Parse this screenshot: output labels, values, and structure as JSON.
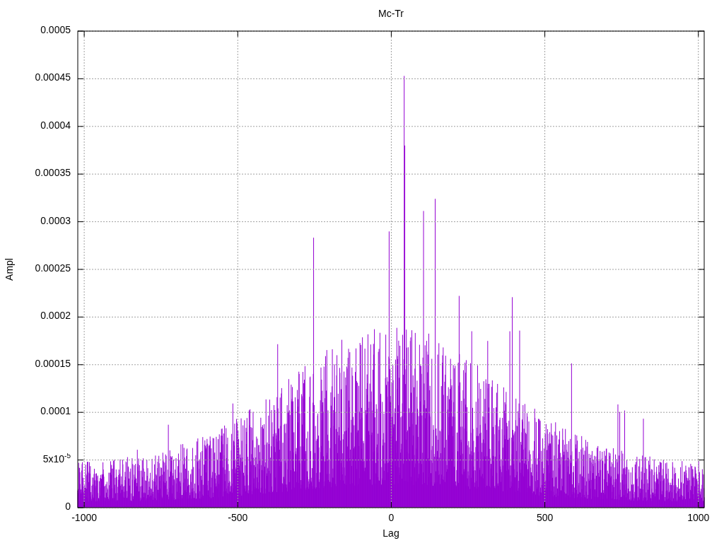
{
  "chart_data": {
    "type": "line",
    "title": "Mc-Tr",
    "xlabel": "Lag",
    "ylabel": "Ampl",
    "xlim": [
      -1021,
      1019
    ],
    "ylim": [
      0,
      0.0005
    ],
    "grid": true,
    "xticks": [
      {
        "value": -1000,
        "label": "-1000"
      },
      {
        "value": -500,
        "label": "-500"
      },
      {
        "value": 0,
        "label": "0"
      },
      {
        "value": 500,
        "label": "500"
      },
      {
        "value": 1000,
        "label": "1000"
      }
    ],
    "yticks": [
      0,
      {
        "value": 5e-05,
        "label": "5x10$^{-5}$"
      },
      0.0001,
      0.00015,
      0.0002,
      0.00025,
      0.0003,
      0.00035,
      0.0004,
      0.00045,
      0.0005
    ]
  }
}
